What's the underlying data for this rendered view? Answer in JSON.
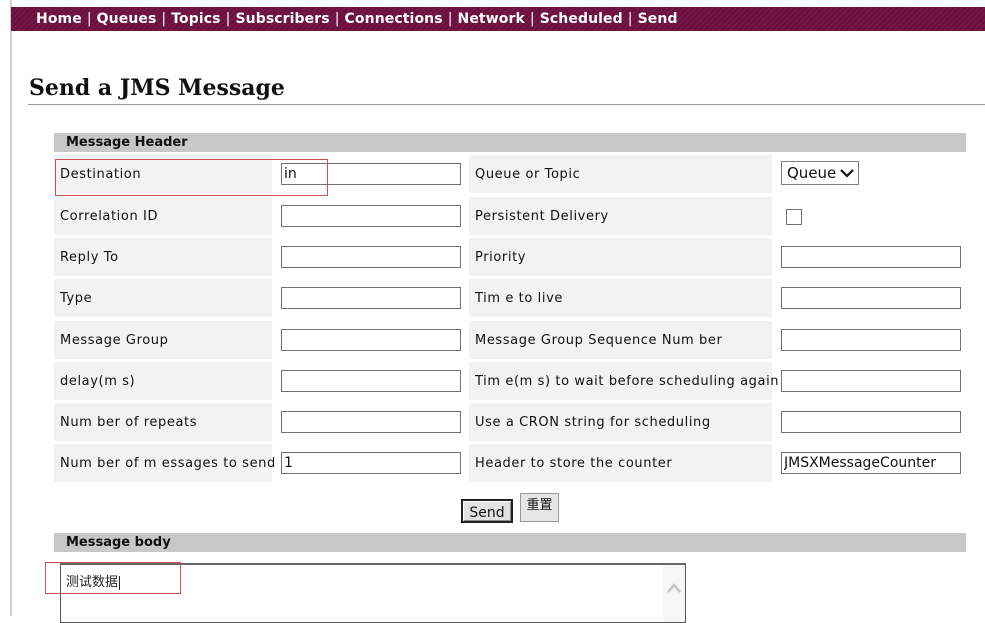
{
  "nav": {
    "items": [
      "Home",
      "Queues",
      "Topics",
      "Subscribers",
      "Connections",
      "Network",
      "Scheduled",
      "Send"
    ]
  },
  "page": {
    "title": "Send a JMS Message"
  },
  "header_section": {
    "title": "Message Header",
    "rows": [
      {
        "left_label": "Destination",
        "left_value": "in",
        "right_label": "Queue or Topic",
        "right_type": "select",
        "right_value": "Queue"
      },
      {
        "left_label": "Correlation ID",
        "left_value": "",
        "right_label": "Persistent Delivery",
        "right_type": "checkbox",
        "right_checked": false
      },
      {
        "left_label": "Reply To",
        "left_value": "",
        "right_label": "Priority",
        "right_type": "text",
        "right_value": ""
      },
      {
        "left_label": "Type",
        "left_value": "",
        "right_label": "Tim e to live",
        "right_type": "text",
        "right_value": ""
      },
      {
        "left_label": "Message Group",
        "left_value": "",
        "right_label": "Message Group Sequence Num ber",
        "right_type": "text",
        "right_value": ""
      },
      {
        "left_label": "delay(m s)",
        "left_value": "",
        "right_label": "Tim e(m s) to wait before scheduling again",
        "right_type": "text",
        "right_value": ""
      },
      {
        "left_label": "Num ber of repeats",
        "left_value": "",
        "right_label": "Use a CRON string for scheduling",
        "right_type": "text",
        "right_value": ""
      },
      {
        "left_label": "Num ber of m essages to send",
        "left_value": "1",
        "right_label": "Header to store the counter",
        "right_type": "text",
        "right_value": "JMSXMessageCounter"
      }
    ]
  },
  "buttons": {
    "send": "Send",
    "reset": "重置"
  },
  "body_section": {
    "title": "Message body",
    "value": "测试数据"
  },
  "colors": {
    "nav_bg": "#6e1040",
    "section_bg": "#c8c8c8",
    "cell_bg": "#f2f2f2",
    "annotation": "#d2504a"
  }
}
